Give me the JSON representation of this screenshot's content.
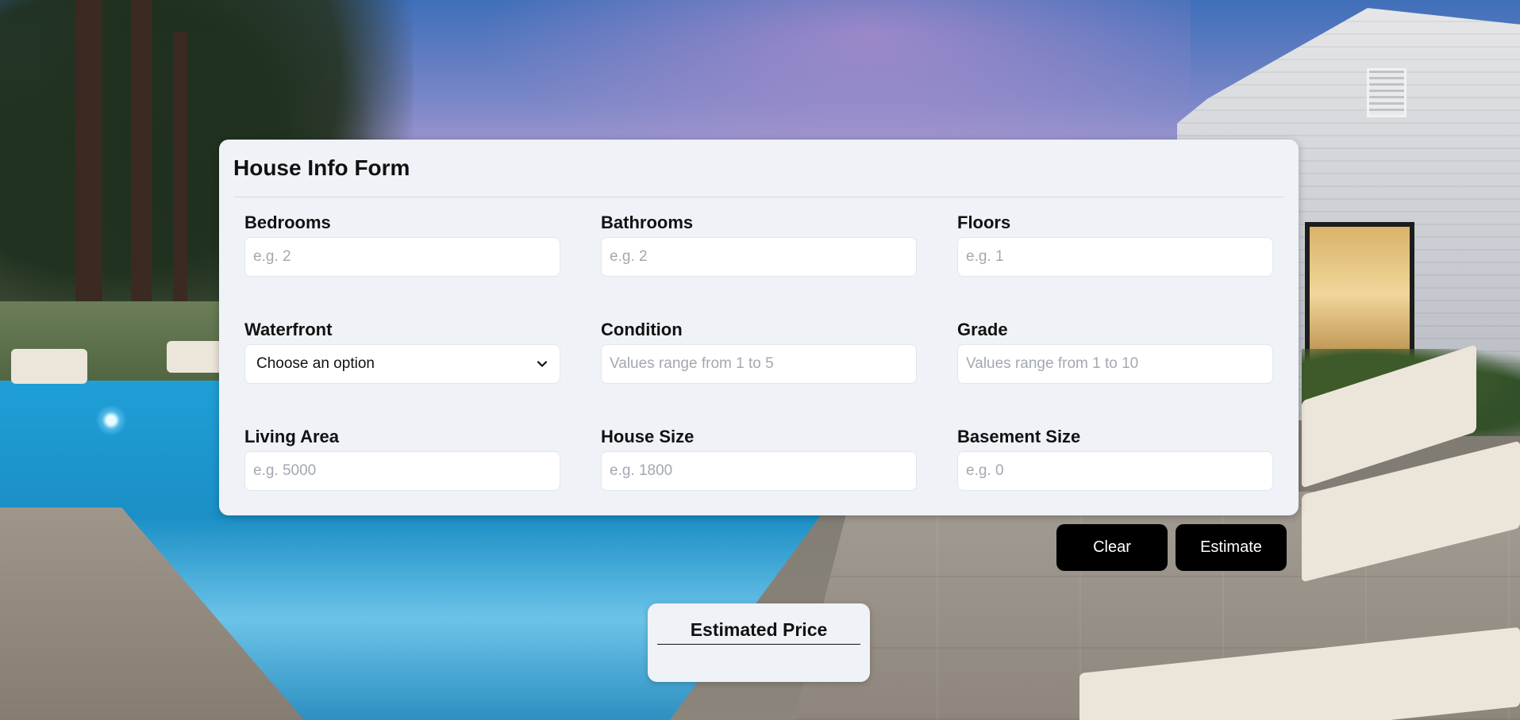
{
  "form": {
    "title": "House Info Form",
    "fields": {
      "bedrooms": {
        "label": "Bedrooms",
        "placeholder": "e.g. 2",
        "value": ""
      },
      "bathrooms": {
        "label": "Bathrooms",
        "placeholder": "e.g. 2",
        "value": ""
      },
      "floors": {
        "label": "Floors",
        "placeholder": "e.g. 1",
        "value": ""
      },
      "waterfront": {
        "label": "Waterfront",
        "selected": "Choose an option",
        "icon": "chevron-down-icon"
      },
      "condition": {
        "label": "Condition",
        "placeholder": "Values range from 1 to 5",
        "value": ""
      },
      "grade": {
        "label": "Grade",
        "placeholder": "Values range from 1 to 10",
        "value": ""
      },
      "living_area": {
        "label": "Living Area",
        "placeholder": "e.g. 5000",
        "value": ""
      },
      "house_size": {
        "label": "House Size",
        "placeholder": "e.g. 1800",
        "value": ""
      },
      "basement_size": {
        "label": "Basement Size",
        "placeholder": "e.g. 0",
        "value": ""
      }
    }
  },
  "actions": {
    "clear_label": "Clear",
    "estimate_label": "Estimate"
  },
  "result": {
    "title": "Estimated Price",
    "value": ""
  },
  "colors": {
    "card_background": "#eff2f7",
    "button_background": "#000000",
    "button_text": "#ffffff"
  }
}
